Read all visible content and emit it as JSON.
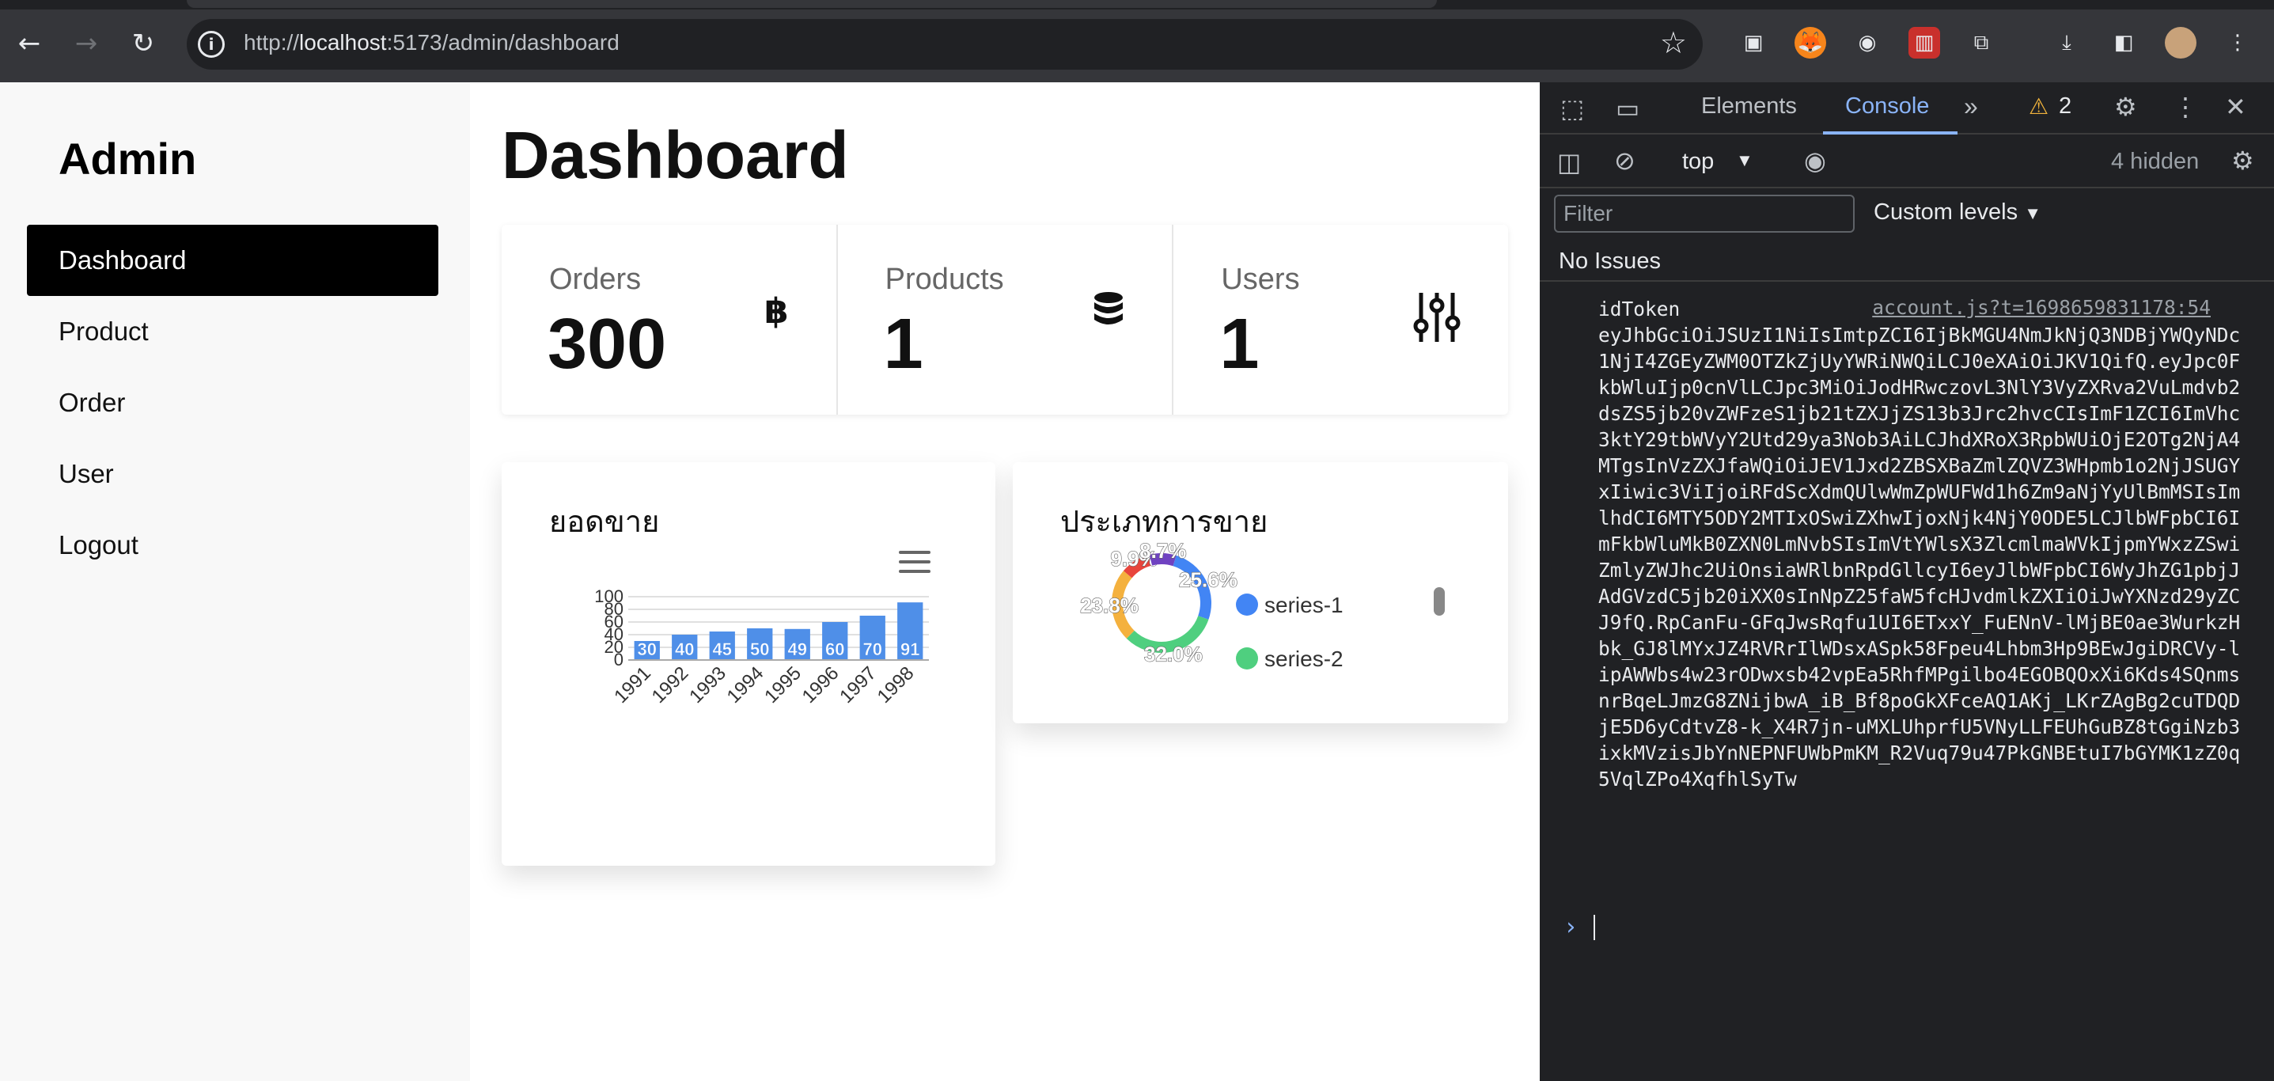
{
  "browser": {
    "url_prefix": "http://",
    "url_host": "localhost",
    "url_rest": ":5173/admin/dashboard"
  },
  "sidebar": {
    "brand": "Admin",
    "items": [
      {
        "label": "Dashboard",
        "active": true
      },
      {
        "label": "Product",
        "active": false
      },
      {
        "label": "Order",
        "active": false
      },
      {
        "label": "User",
        "active": false
      },
      {
        "label": "Logout",
        "active": false
      }
    ]
  },
  "main": {
    "title": "Dashboard",
    "stats": [
      {
        "label": "Orders",
        "value": "300",
        "icon": "baht-icon"
      },
      {
        "label": "Products",
        "value": "1",
        "icon": "database-icon"
      },
      {
        "label": "Users",
        "value": "1",
        "icon": "sliders-icon"
      }
    ],
    "sales_card_title": "ยอดขาย",
    "type_card_title": "ประเภทการขาย"
  },
  "chart_data": [
    {
      "type": "bar",
      "title": "ยอดขาย",
      "categories": [
        "1991",
        "1992",
        "1993",
        "1994",
        "1995",
        "1996",
        "1997",
        "1998"
      ],
      "values": [
        30,
        40,
        45,
        50,
        49,
        60,
        70,
        91
      ],
      "yticks": [
        "100",
        "80",
        "60",
        "40",
        "20",
        "0"
      ],
      "ylim": [
        0,
        100
      ],
      "color": "#4f8fe8"
    },
    {
      "type": "pie",
      "title": "ประเภทการขาย",
      "labels": [
        "25.6%",
        "32.0%",
        "23.8%",
        "9.9%",
        "8.7%"
      ],
      "values": [
        25.6,
        32.0,
        23.8,
        9.9,
        8.7
      ],
      "colors": [
        "#4285f4",
        "#4fcf7f",
        "#f4b13e",
        "#e8453c",
        "#6f42c1"
      ],
      "legend": [
        "series-1",
        "series-2"
      ]
    }
  ],
  "devtools": {
    "tabs": [
      "Elements",
      "Console"
    ],
    "active_tab": "Console",
    "warnings": "2",
    "context": "top",
    "hidden": "4 hidden",
    "filter_placeholder": "Filter",
    "levels": "Custom levels",
    "issues": "No Issues",
    "log_label": "idToken",
    "log_source": "account.js?t=1698659831178:54",
    "log_text": "eyJhbGciOiJSUzI1NiIsImtpZCI6IjBkMGU4NmJkNjQ3NDBjYWQyNDc1NjI4ZGEyZWM0OTZkZjUyYWRiNWQiLCJ0eXAiOiJKV1QifQ.eyJpc0FkbWluIjp0cnVlLCJpc3MiOiJodHRwczovL3NlY3VyZXRva2VuLmdvb2dsZS5jb20vZWFzeS1jb21tZXJjZS13b3Jrc2hvcCIsImF1ZCI6ImVhc3ktY29tbWVyY2Utd29ya3Nob3AiLCJhdXRoX3RpbWUiOjE2OTg2NjA4MTgsInVzZXJfaWQiOiJEV1Jxd2ZBSXBaZmlZQVZ3WHpmb1o2NjJSUGYxIiwic3ViIjoiRFdScXdmQUlwWmZpWUFWd1h6Zm9aNjYyUlBmMSIsImlhdCI6MTY5ODY2MTIxOSwiZXhwIjoxNjk4NjY0ODE5LCJlbWFpbCI6ImFkbWluMkB0ZXN0LmNvbSIsImVtYWlsX3ZlcmlmaWVkIjpmYWxzZSwiZmlyZWJhc2UiOnsiaWRlbnRpdGllcyI6eyJlbWFpbCI6WyJhZG1pbjJAdGVzdC5jb20iXX0sInNpZ25faW5fcHJvdmlkZXIiOiJwYXNzd29yZCJ9fQ.RpCanFu-GFqJwsRqfu1UI6ETxxY_FuENnV-lMjBE0ae3WurkzHbk_GJ8lMYxJZ4RVRrIlWDsxASpk58Fpeu4Lhbm3Hp9BEwJgiDRCVy-lipAWWbs4w23rODwxsb42vpEa5RhfMPgilbo4EGOBQOxXi6Kds4SQnmsnrBqeLJmzG8ZNijbwA_iB_Bf8poGkXFceAQ1AKj_LKrZAgBg2cuTDQDjE5D6yCdtvZ8-k_X4R7jn-uMXLUhprfU5VNyLLFEUhGuBZ8tGgiNzb3ixkMVzisJbYnNEPNFUWbPmKM_R2Vuq79u47PkGNBEtuI7bGYMK1zZ0q5VqlZPo4XqfhlSyTw"
  }
}
